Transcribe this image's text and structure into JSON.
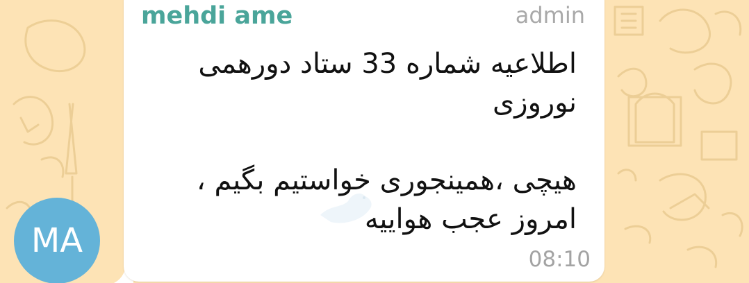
{
  "chat": {
    "background_color": "#fde3b5",
    "avatar": {
      "initials": "MA",
      "color": "#64b3d8"
    },
    "message": {
      "sender_name": "mehdi ame",
      "sender_color": "#4aa59a",
      "sender_role": "admin",
      "paragraph_1": "اطلاعیه شماره 33 ستاد دورهمی نوروزی",
      "paragraph_2": "هیچی ،همینجوری خواستیم بگیم ، امروز عجب هواییه",
      "time": "08:10"
    }
  }
}
